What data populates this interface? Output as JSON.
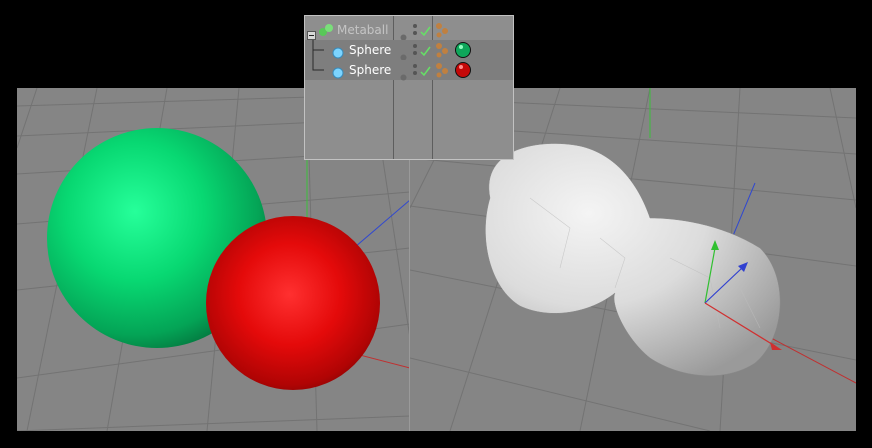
{
  "object_manager": {
    "items": [
      {
        "label": "Metaball",
        "type": "metaball",
        "level": 0,
        "dimmed": true,
        "expanded": true
      },
      {
        "label": "Sphere",
        "type": "sphere",
        "level": 1,
        "material_color": "#0fa65a",
        "visible": true,
        "enabled": true
      },
      {
        "label": "Sphere",
        "type": "sphere",
        "level": 1,
        "material_color": "#c40808",
        "visible": true,
        "enabled": true
      }
    ],
    "colors": {
      "background": "#8e8e8e",
      "row_selected": "#7e7e7e",
      "check": "#66e066"
    }
  },
  "viewports": {
    "left": {
      "shading": "gouraud",
      "objects": [
        "green-sphere",
        "red-sphere"
      ],
      "floor_color": "#858585",
      "grid_color": "#6e6e6e"
    },
    "right": {
      "shading": "metaball-mesh",
      "objects": [
        "metaball-mesh"
      ],
      "floor_color": "#858585",
      "grid_color": "#6e6e6e"
    }
  },
  "axis_colors": {
    "x": "#d03030",
    "y": "#30c030",
    "z": "#3040d0"
  }
}
